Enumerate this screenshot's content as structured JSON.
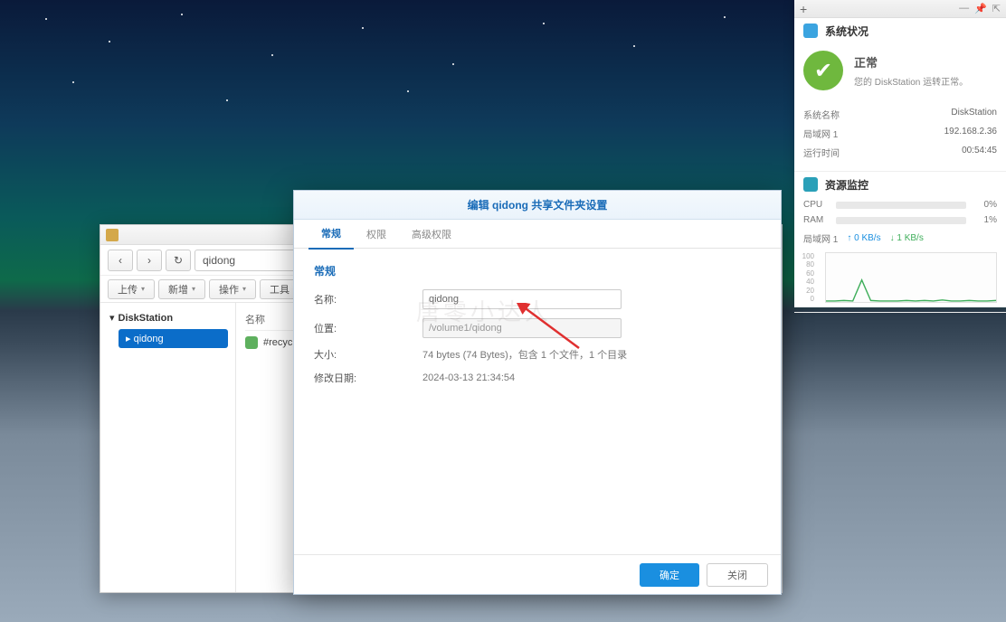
{
  "file_browser": {
    "path_input": "qidong",
    "toolbar": {
      "upload": "上传",
      "new": "新增",
      "action": "操作",
      "tools": "工具"
    },
    "sidebar": {
      "root": "DiskStation",
      "child": "qidong"
    },
    "column_header": "名称",
    "rows": [
      {
        "name": "#recyc"
      }
    ]
  },
  "dialog": {
    "title": "编辑 qidong 共享文件夹设置",
    "tabs": [
      "常规",
      "权限",
      "高级权限"
    ],
    "section": "常规",
    "fields": {
      "name_label": "名称:",
      "name_value": "qidong",
      "location_label": "位置:",
      "location_value": "/volume1/qidong",
      "size_label": "大小:",
      "size_value": "74 bytes (74 Bytes)，包含 1 个文件，1 个目录",
      "date_label": "修改日期:",
      "date_value": "2024-03-13 21:34:54"
    },
    "buttons": {
      "ok": "确定",
      "cancel": "关闭"
    }
  },
  "widget": {
    "system_status": {
      "title": "系统状况",
      "status_main": "正常",
      "status_sub": "您的 DiskStation 运转正常。",
      "rows": [
        {
          "k": "系统名称",
          "v": "DiskStation"
        },
        {
          "k": "局域网 1",
          "v": "192.168.2.36"
        },
        {
          "k": "运行时间",
          "v": "00:54:45"
        }
      ]
    },
    "resource": {
      "title": "资源监控",
      "cpu": {
        "label": "CPU",
        "pct": "0%"
      },
      "ram": {
        "label": "RAM",
        "pct": "1%"
      },
      "net_label": "局域网 1",
      "net_up": "0 KB/s",
      "net_dn": "1 KB/s",
      "y_labels": [
        "100",
        "80",
        "60",
        "40",
        "20",
        "0"
      ]
    }
  },
  "chart_data": {
    "type": "line",
    "title": "Network throughput",
    "ylim": [
      0,
      100
    ],
    "y_ticks": [
      0,
      20,
      40,
      60,
      80,
      100
    ],
    "series": [
      {
        "name": "局域网 1",
        "color": "#3eae5a",
        "values": [
          2,
          2,
          3,
          2,
          45,
          3,
          2,
          2,
          2,
          3,
          2,
          3,
          2,
          4,
          2,
          2,
          3,
          2,
          2,
          3
        ]
      }
    ]
  }
}
